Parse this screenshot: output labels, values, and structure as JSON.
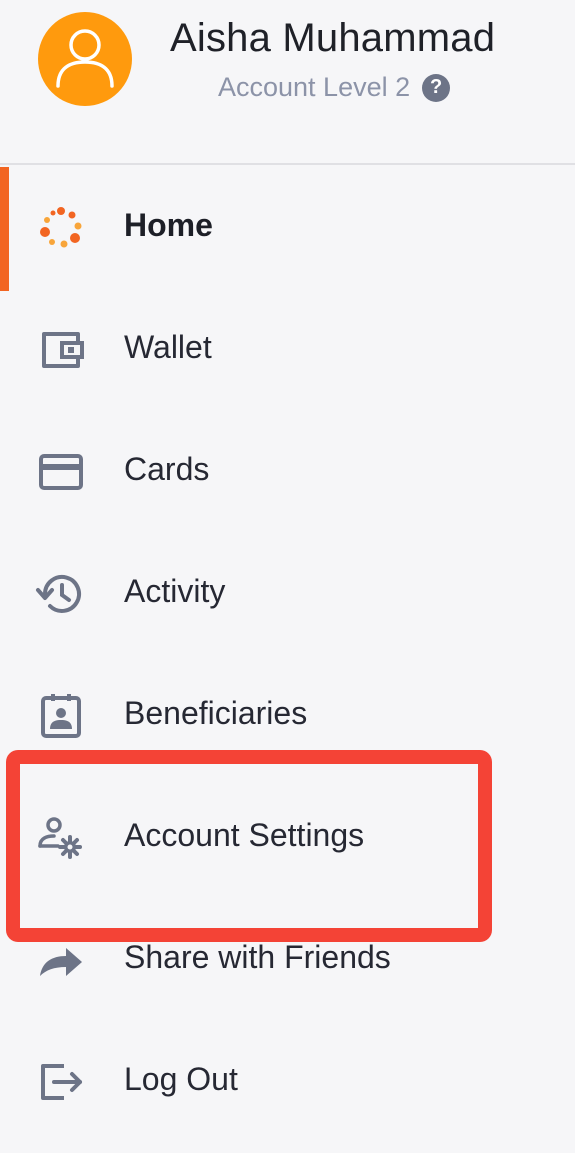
{
  "profile": {
    "name": "Aisha Muhammad",
    "level": "Account Level 2",
    "help_icon": "?",
    "avatar_icon": "user-avatar-icon",
    "avatar_color": "#ff9a0d"
  },
  "menu": {
    "active_color": "#f26522",
    "items": [
      {
        "label": "Home",
        "icon": "home-dots-icon",
        "active": true
      },
      {
        "label": "Wallet",
        "icon": "wallet-icon",
        "active": false
      },
      {
        "label": "Cards",
        "icon": "card-icon",
        "active": false
      },
      {
        "label": "Activity",
        "icon": "history-icon",
        "active": false
      },
      {
        "label": "Beneficiaries",
        "icon": "contact-badge-icon",
        "active": false
      },
      {
        "label": "Account Settings",
        "icon": "user-settings-icon",
        "active": false,
        "highlighted": true
      },
      {
        "label": "Share with Friends",
        "icon": "share-icon",
        "active": false
      },
      {
        "label": "Log Out",
        "icon": "logout-icon",
        "active": false
      }
    ]
  },
  "annotation": {
    "highlight_color": "#f44336",
    "highlight_target": "Account Settings"
  }
}
